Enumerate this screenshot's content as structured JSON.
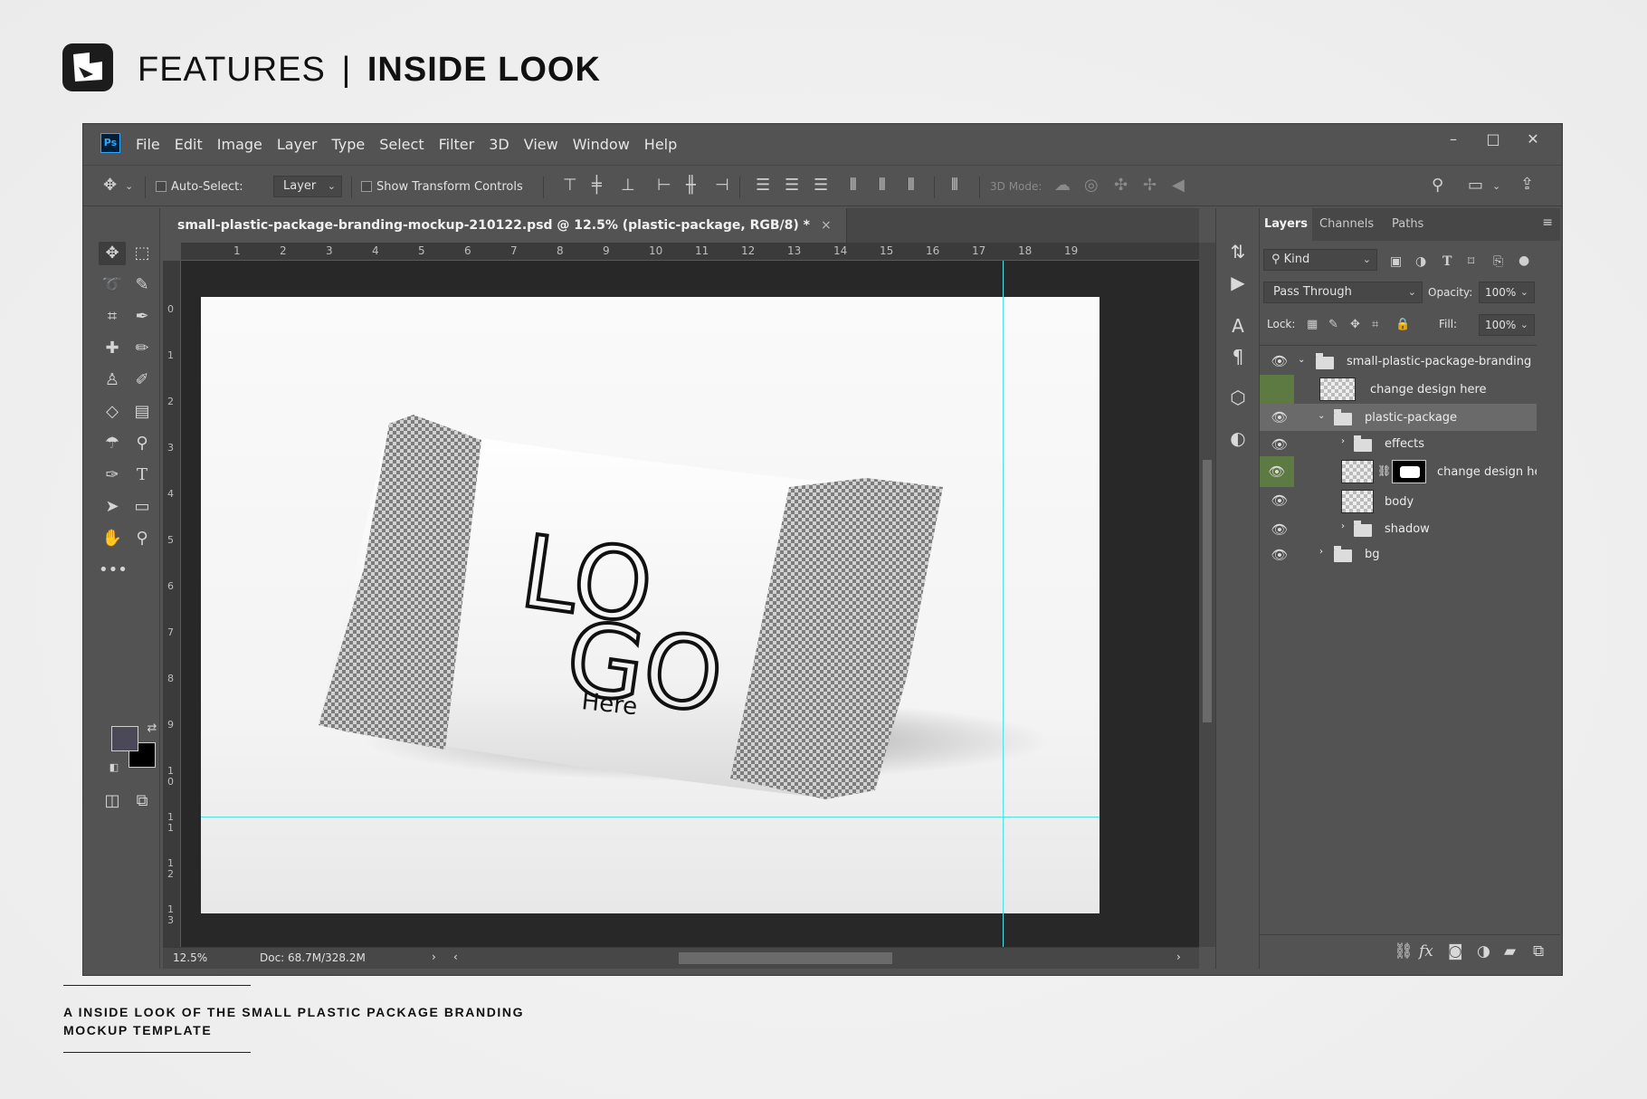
{
  "brand": {
    "icon": "brand-logo-icon"
  },
  "heading": {
    "prefix": "FEATURES",
    "separator": "|",
    "title": "INSIDE LOOK"
  },
  "caption": {
    "line1": "A INSIDE LOOK OF THE SMALL PLASTIC PACKAGE BRANDING",
    "line2": "MOCKUP TEMPLATE"
  },
  "app": {
    "logo": "Ps",
    "menu": [
      "File",
      "Edit",
      "Image",
      "Layer",
      "Type",
      "Select",
      "Filter",
      "3D",
      "View",
      "Window",
      "Help"
    ],
    "window_controls": [
      "–",
      "□",
      "✕"
    ],
    "options": {
      "auto_select_label": "Auto-Select:",
      "auto_select_value": "Layer",
      "show_transform_label": "Show Transform Controls",
      "mode_3d_label": "3D Mode:"
    },
    "document": {
      "tab_title": "small-plastic-package-branding-mockup-210122.psd @ 12.5% (plastic-package, RGB/8) *",
      "close": "×",
      "ruler_h": [
        "1",
        "2",
        "3",
        "4",
        "5",
        "6",
        "7",
        "8",
        "9",
        "10",
        "11",
        "12",
        "13",
        "14",
        "15",
        "16",
        "17",
        "18",
        "19"
      ],
      "ruler_v": [
        "0",
        "1",
        "2",
        "3",
        "4",
        "5",
        "6",
        "7",
        "8",
        "9",
        "10",
        "11",
        "12",
        "13"
      ],
      "zoom": "12.5%",
      "doc_info": "Doc: 68.7M/328.2M",
      "art": {
        "logo_line1": "LO",
        "logo_line2": "GO",
        "logo_sub": "Here"
      }
    },
    "layers_panel": {
      "tabs": [
        "Layers",
        "Channels",
        "Paths"
      ],
      "kind_label": "Kind",
      "blend_mode": "Pass Through",
      "opacity_label": "Opacity:",
      "opacity_value": "100%",
      "lock_label": "Lock:",
      "fill_label": "Fill:",
      "fill_value": "100%",
      "layers": [
        {
          "name": "small-plastic-package-branding"
        },
        {
          "name": "change design here"
        },
        {
          "name": "plastic-package"
        },
        {
          "name": "effects"
        },
        {
          "name": "change design here"
        },
        {
          "name": "body"
        },
        {
          "name": "shadow"
        },
        {
          "name": "bg"
        }
      ],
      "footer_icons": [
        "link-icon",
        "fx-icon",
        "mask-icon",
        "adjustment-icon",
        "group-icon",
        "new-layer-icon",
        "trash-icon"
      ]
    }
  },
  "colors": {
    "accent_guide": "#4ee1e8",
    "foreground_swatch": "#4b4858",
    "background_swatch": "#000000",
    "visibility_highlight": "#5e7a43"
  }
}
